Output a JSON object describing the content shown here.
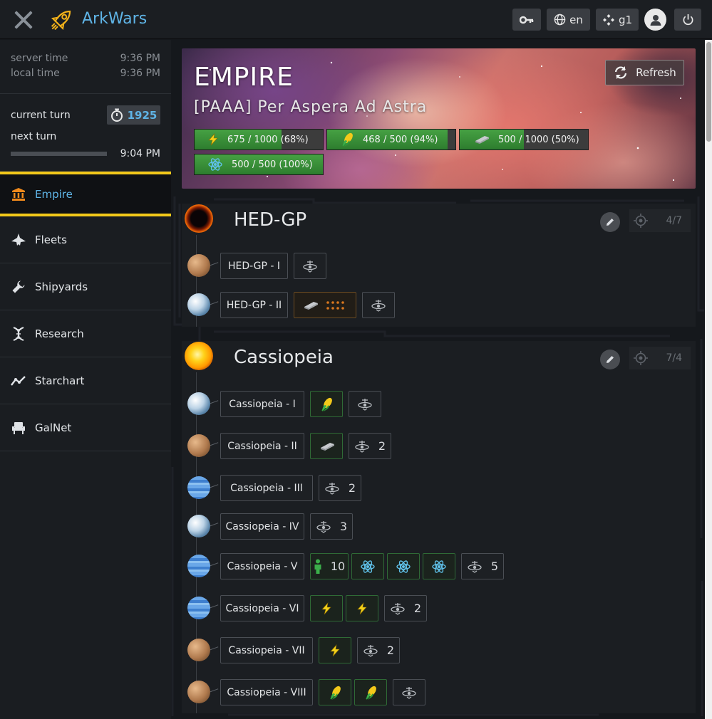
{
  "app": {
    "title": "ArkWars",
    "accent": "#5fb4e6",
    "highlight": "#f3c91a"
  },
  "topbar": {
    "language": "en",
    "game": "g1"
  },
  "sidebar": {
    "server_time_label": "server time",
    "server_time": "9:36 PM",
    "local_time_label": "local time",
    "local_time": "9:36 PM",
    "current_turn_label": "current turn",
    "current_turn": "1925",
    "next_turn_label": "next turn",
    "next_turn_time": "9:04 PM",
    "next_turn_progress": 0,
    "nav": [
      {
        "label": "Empire",
        "icon": "bank-icon",
        "active": true
      },
      {
        "label": "Fleets",
        "icon": "starfighter-icon",
        "active": false
      },
      {
        "label": "Shipyards",
        "icon": "wrench-icon",
        "active": false
      },
      {
        "label": "Research",
        "icon": "dna-icon",
        "active": false
      },
      {
        "label": "Starchart",
        "icon": "line-chart-icon",
        "active": false
      },
      {
        "label": "GalNet",
        "icon": "seat-icon",
        "active": false
      }
    ]
  },
  "empire": {
    "title": "EMPIRE",
    "name": "[PAAA] Per Aspera Ad Astra",
    "refresh_label": "Refresh",
    "resources": [
      {
        "icon": "lightning-icon",
        "text": "675 / 1000 (68%)",
        "fraction": 0.68
      },
      {
        "icon": "corn-icon",
        "text": "468 / 500 (94%)",
        "fraction": 0.94
      },
      {
        "icon": "metal-bar-icon",
        "text": "500 / 1000 (50%)",
        "fraction": 0.5
      },
      {
        "icon": "atom-icon",
        "text": "500 / 500 (100%)",
        "fraction": 1.0
      }
    ]
  },
  "systems": [
    {
      "name": "HED-GP",
      "ratio": "4/7",
      "star": "black-hole-icon",
      "planets": [
        {
          "name": "HED-GP - I",
          "type": "desert",
          "items": [
            {
              "kind": "orbital",
              "count": ""
            }
          ]
        },
        {
          "name": "HED-GP - II",
          "type": "earth",
          "items": [
            {
              "kind": "metal-build",
              "count": ""
            },
            {
              "kind": "orbital",
              "count": ""
            }
          ]
        }
      ]
    },
    {
      "name": "Cassiopeia",
      "ratio": "7/4",
      "star": "sun-icon",
      "planets": [
        {
          "name": "Cassiopeia - I",
          "type": "earth",
          "items": [
            {
              "kind": "corn",
              "count": ""
            },
            {
              "kind": "orbital",
              "count": ""
            }
          ]
        },
        {
          "name": "Cassiopeia - II",
          "type": "desert",
          "items": [
            {
              "kind": "metal",
              "count": ""
            },
            {
              "kind": "orbital",
              "count": "2"
            }
          ]
        },
        {
          "name": "Cassiopeia - III",
          "type": "gas",
          "items": [
            {
              "kind": "orbital",
              "count": "2"
            }
          ]
        },
        {
          "name": "Cassiopeia - IV",
          "type": "earth",
          "items": [
            {
              "kind": "orbital",
              "count": "3"
            }
          ]
        },
        {
          "name": "Cassiopeia - V",
          "type": "gas",
          "items": [
            {
              "kind": "population",
              "count": "10"
            },
            {
              "kind": "atom",
              "count": ""
            },
            {
              "kind": "atom",
              "count": ""
            },
            {
              "kind": "atom",
              "count": ""
            },
            {
              "kind": "orbital",
              "count": "5"
            }
          ]
        },
        {
          "name": "Cassiopeia - VI",
          "type": "gas",
          "items": [
            {
              "kind": "lightning",
              "count": ""
            },
            {
              "kind": "lightning",
              "count": ""
            },
            {
              "kind": "orbital",
              "count": "2"
            }
          ]
        },
        {
          "name": "Cassiopeia - VII",
          "type": "desert",
          "items": [
            {
              "kind": "lightning",
              "count": ""
            },
            {
              "kind": "orbital",
              "count": "2"
            }
          ]
        },
        {
          "name": "Cassiopeia - VIII",
          "type": "desert",
          "items": [
            {
              "kind": "corn",
              "count": ""
            },
            {
              "kind": "corn",
              "count": ""
            },
            {
              "kind": "orbital",
              "count": ""
            }
          ]
        }
      ]
    }
  ]
}
